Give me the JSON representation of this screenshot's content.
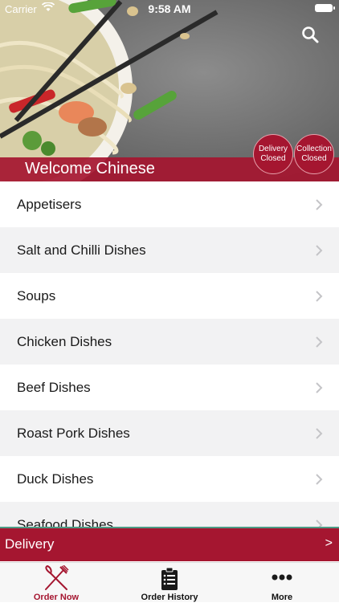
{
  "status_bar": {
    "carrier": "Carrier",
    "time": "9:58 AM"
  },
  "header": {
    "welcome": "Welcome Chinese",
    "delivery_status": {
      "line1": "Delivery",
      "line2": "Closed"
    },
    "collection_status": {
      "line1": "Collection",
      "line2": "Closed"
    }
  },
  "menu": {
    "items": [
      {
        "label": "Appetisers"
      },
      {
        "label": "Salt and Chilli Dishes"
      },
      {
        "label": "Soups"
      },
      {
        "label": "Chicken Dishes"
      },
      {
        "label": "Beef Dishes"
      },
      {
        "label": "Roast Pork Dishes"
      },
      {
        "label": "Duck Dishes"
      },
      {
        "label": "Seafood Dishes"
      }
    ]
  },
  "delivery_bar": {
    "label": "Delivery",
    "arrow": ">"
  },
  "tabs": [
    {
      "label": "Order Now",
      "icon": "fork-knife-icon"
    },
    {
      "label": "Order History",
      "icon": "clipboard-icon"
    },
    {
      "label": "More",
      "icon": "more-dots-icon"
    }
  ],
  "colors": {
    "brand": "#a51630",
    "accent_line": "#4d9b85",
    "active_tab": "#a51630"
  }
}
